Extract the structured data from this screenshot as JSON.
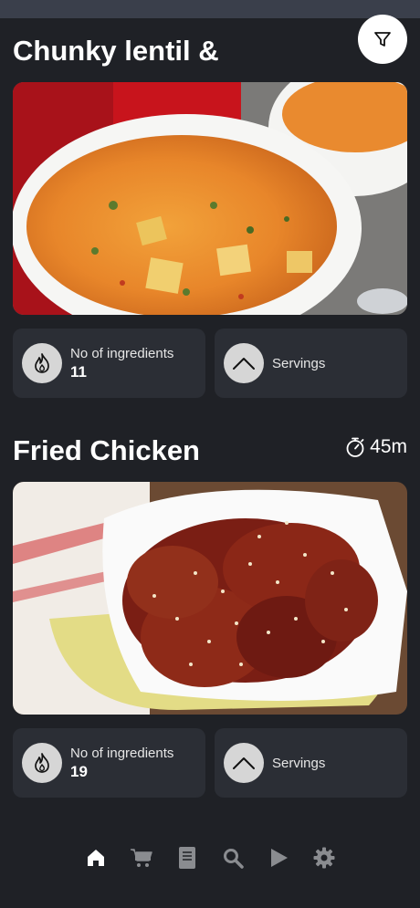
{
  "recipes": [
    {
      "title": "Chunky lentil &",
      "ingredients_label": "No of ingredients",
      "ingredients_count": "11",
      "servings_label": "Servings",
      "image_icon": "soup-bowl-photo"
    },
    {
      "title": "Fried Chicken",
      "time": "45m",
      "ingredients_label": "No of ingredients",
      "ingredients_count": "19",
      "servings_label": "Servings",
      "image_icon": "fried-chicken-photo"
    }
  ],
  "nav": {
    "items": [
      "home-icon",
      "cart-icon",
      "book-icon",
      "search-icon",
      "play-icon",
      "settings-icon"
    ],
    "active": "home-icon"
  },
  "colors": {
    "background": "#3a3f4b",
    "card": "#1f2126",
    "tile": "#2b2e35",
    "active_nav": "#ffffff",
    "inactive_nav": "#8a8c90"
  }
}
